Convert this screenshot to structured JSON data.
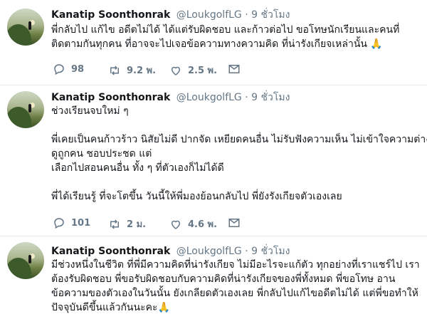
{
  "tweets": [
    {
      "name": "Kanatip Soonthonrak",
      "handle": "@LoukgolfLG",
      "dot": "·",
      "time": "9 ชั่วโมง",
      "lines": [
        "พี่กลับไป แก้ไข อดีตไม่ได้ ได้แต่รับผิดชอบ และก้าวต่อไป ขอโทษนักเรียนและคนที่",
        "ติดตามกันทุกคน ที่อาจจะไปเจอข้อความทางความคิด ที่น่ารังเกียจเหล่านั้น 🙏"
      ],
      "replies": "98",
      "retweets": "9.2 พ.",
      "likes": "2.5 พ."
    },
    {
      "name": "Kanatip Soonthonrak",
      "handle": "@LoukgolfLG",
      "dot": "·",
      "time": "9 ชั่วโมง",
      "lines": [
        "ช่วงเรียนจบใหม่ ๆ",
        "",
        "พี่เคยเป็นคนก้าวร้าว นิสัยไม่ดี ปากจัด เหยียดคนอื่น ไม่รับฟังความเห็น ไม่เข้าใจความต่าง",
        "ดูถูกคน ชอบประชด แต่",
        "เลือกไปสอนคนอื่น ทั้ง ๆ ที่ตัวเองก็ไม่ได้ดี",
        "",
        "พี่ได้เรียนรู้ ที่จะโตขึ้น วันนี้ให้พี่มองย้อนกลับไป พี่ยังรังเกียจตัวเองเลย"
      ],
      "replies": "101",
      "retweets": "2 ม.",
      "likes": "4.6 พ."
    },
    {
      "name": "Kanatip Soonthonrak",
      "handle": "@LoukgolfLG",
      "dot": "·",
      "time": "9 ชั่วโมง",
      "lines": [
        "มีช่วงหนึ่งในชีวิต ที่พี่มีความคิดที่น่ารังเกียจ ไม่มีอะไรจะแก้ตัว ทุกอย่างที่เราแชร์ไป เรา",
        "ต้องรับผิดชอบ พี่ขอรับผิดชอบกับความคิดที่น่ารังเกียจของพี่ทั้งหมด พี่ขอโทษ อาน",
        "ข้อความของตัวเองในวันนั้น ยังเกลียดตัวเองเลย พี่กลับไปแก้ไขอดีตไม่ได้ แต่พี่ขอทำให้",
        "ปัจจุบันดีขึ้นแล้วกันนะคะ🙏"
      ]
    }
  ],
  "icons": {
    "reply": "reply-icon",
    "retweet": "retweet-icon",
    "like": "heart-icon",
    "message": "message-icon"
  },
  "colors": {
    "text": "#14171a",
    "muted": "#657786",
    "separator": "#e6ecf0"
  }
}
